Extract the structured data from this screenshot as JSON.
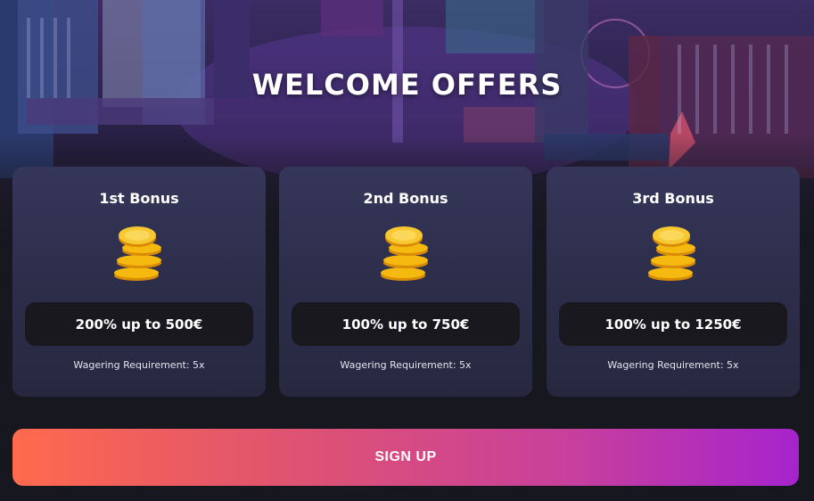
{
  "header": {
    "title": "WELCOME OFFERS"
  },
  "bonuses": [
    {
      "title": "1st Bonus",
      "icon": "coins-icon",
      "amount": "200% up to 500€",
      "wagering": "Wagering Requirement: 5x"
    },
    {
      "title": "2nd Bonus",
      "icon": "coins-icon",
      "amount": "100% up to 750€",
      "wagering": "Wagering Requirement: 5x"
    },
    {
      "title": "3rd Bonus",
      "icon": "coins-icon",
      "amount": "100% up to 1250€",
      "wagering": "Wagering Requirement: 5x"
    }
  ],
  "cta": {
    "label": "SIGN UP"
  },
  "colors": {
    "background": "#17171f",
    "card": "#2f3050",
    "amount_pill": "#19181f",
    "gradient_start": "#ff6a4d",
    "gradient_end": "#a623cd",
    "coin": "#f5b90f"
  }
}
